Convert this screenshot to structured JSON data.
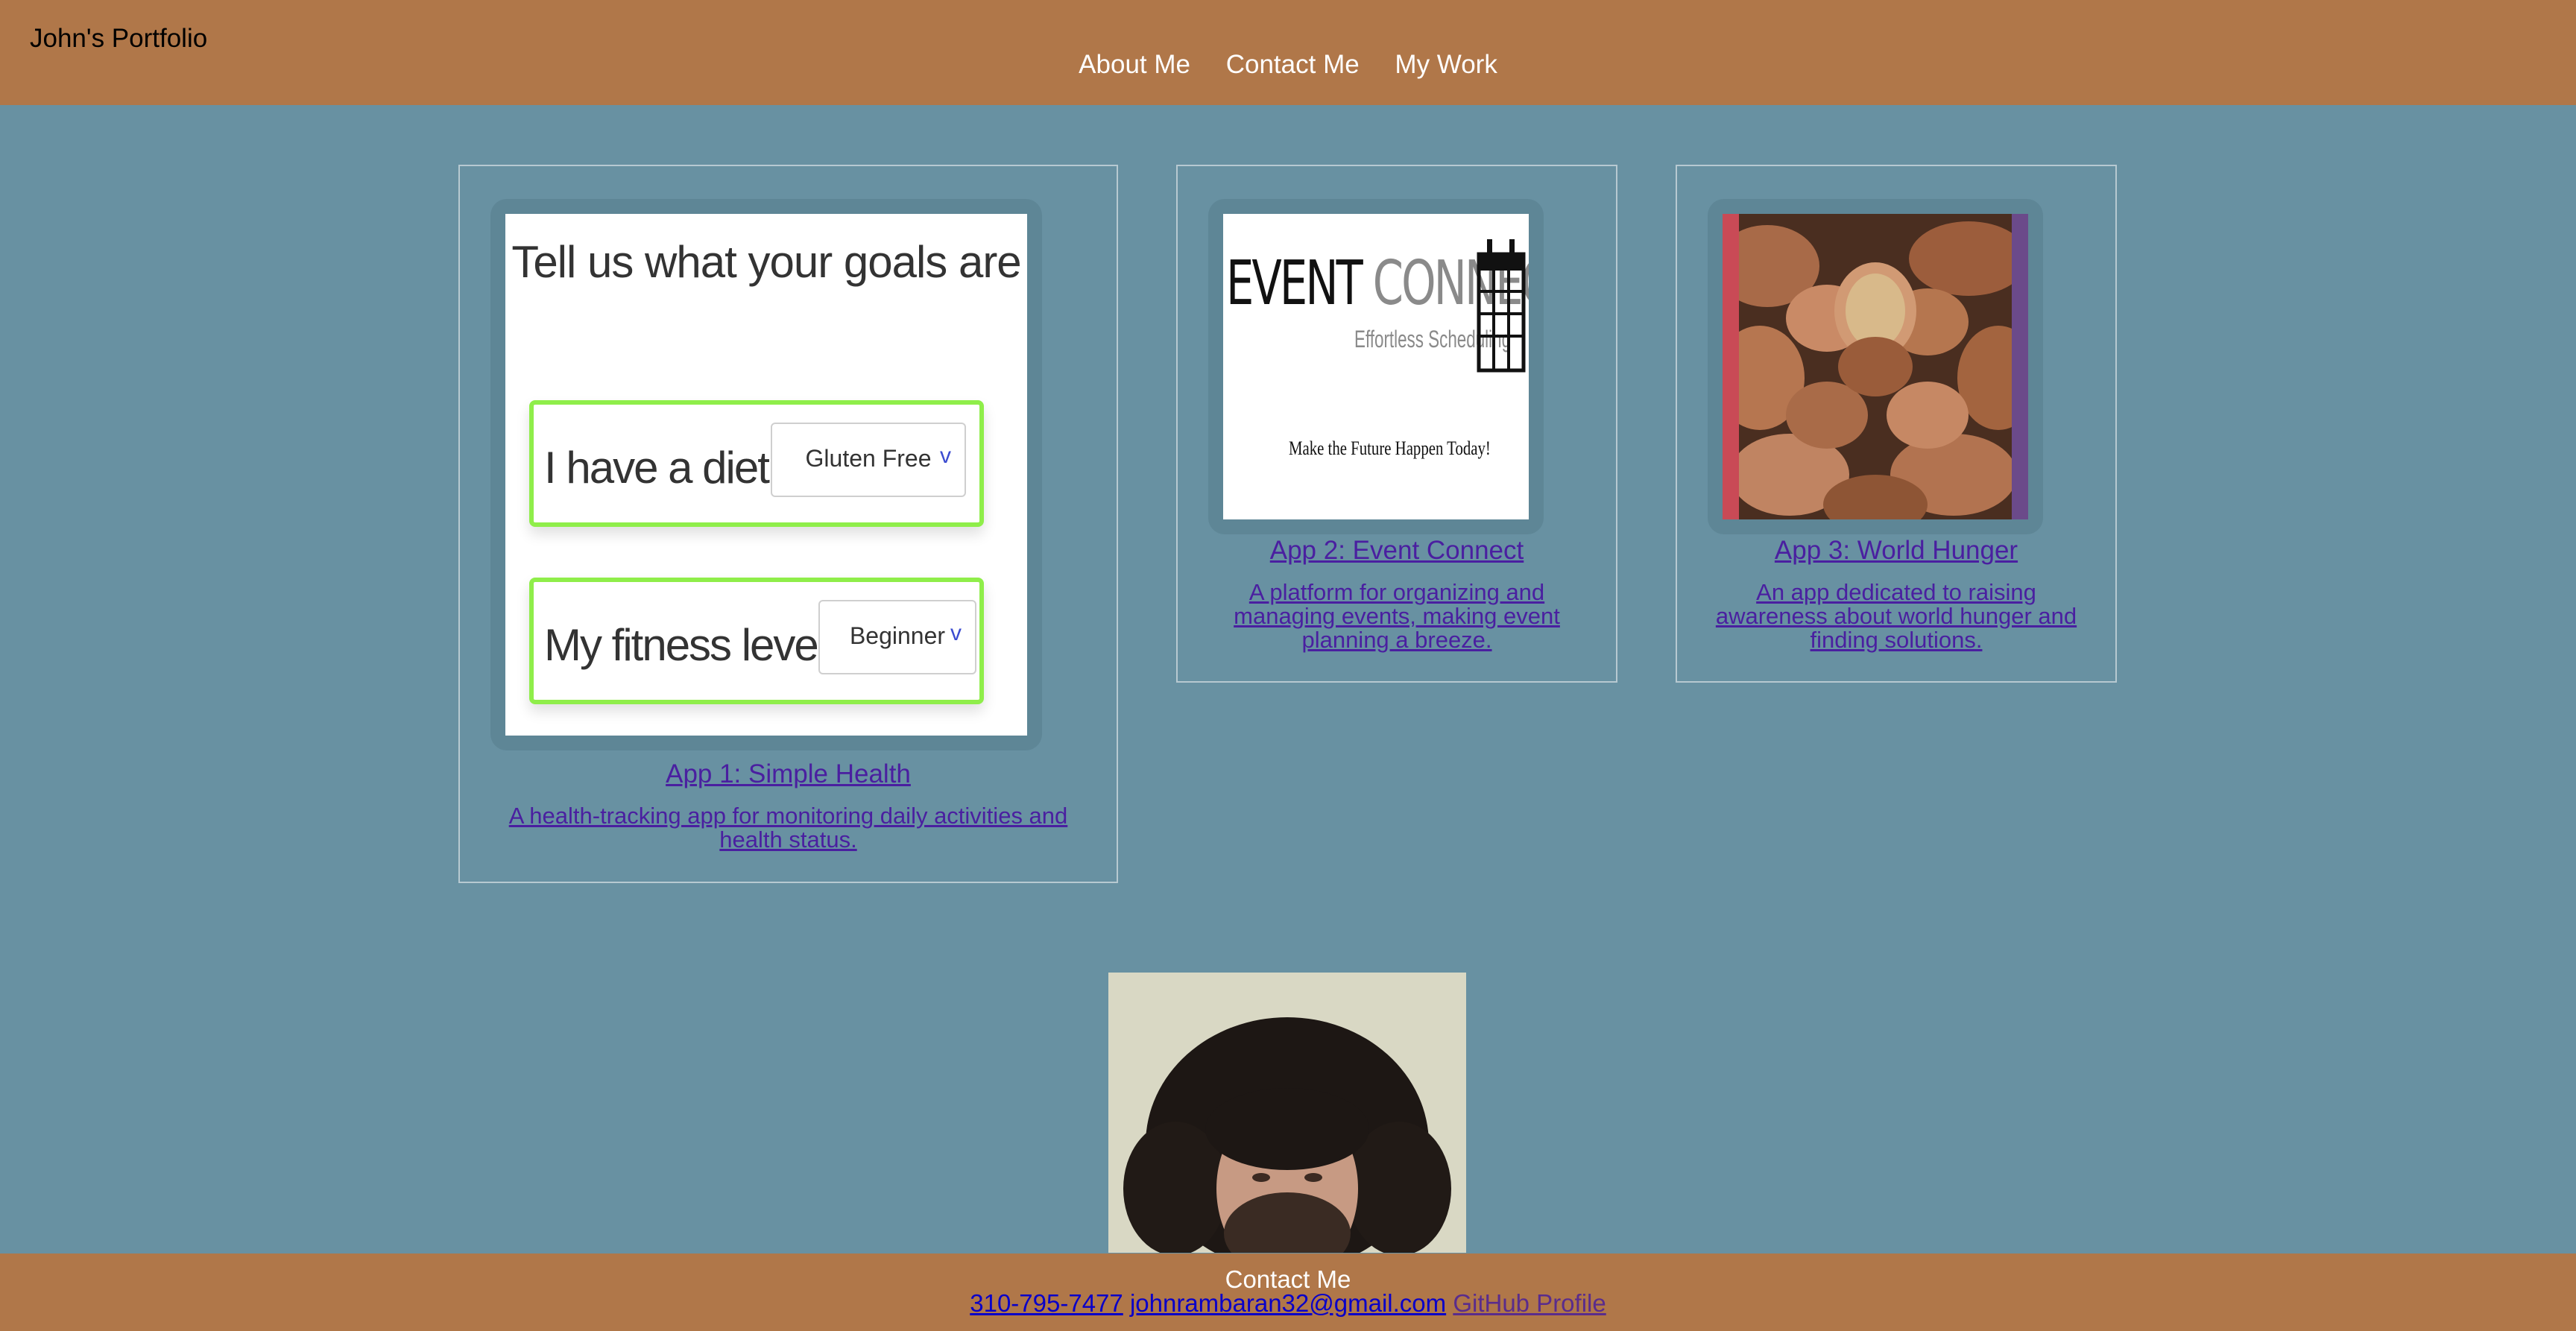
{
  "header": {
    "brand": "John's Portfolio",
    "nav": [
      "About Me",
      "Contact Me",
      "My Work"
    ]
  },
  "projects": [
    {
      "title": "App 1: Simple Health",
      "description": "A health-tracking app for monitoring daily activities and health status.",
      "thumbnail": {
        "heading": "Tell us what your goals are",
        "diet_label": "I have a diet of:",
        "diet_value": "Gluten Free",
        "fitness_label": "My fitness level is:",
        "fitness_value": "Beginner"
      }
    },
    {
      "title": "App 2: Event Connect",
      "description": "A platform for organizing and managing events, making event planning a breeze.",
      "thumbnail": {
        "logo_word1": "EVENT",
        "logo_word2": "CONNECT",
        "tagline": "Effortless Scheduling",
        "motto": "Make the Future Happen Today!"
      }
    },
    {
      "title": "App 3: World Hunger",
      "description": "An app dedicated to raising awareness about world hunger and finding solutions."
    }
  ],
  "footer": {
    "title": "Contact Me",
    "phone": "310-795-7477",
    "email": "johnrambaran32@gmail.com",
    "github": "GitHub Profile"
  },
  "colors": {
    "header_bg": "#b07749",
    "page_bg": "#6891a2",
    "link": "#4a1fa0",
    "accent_green": "#8fee4a"
  },
  "icons": {
    "select_chevron": "chevron-down-icon",
    "calendar": "calendar-icon"
  }
}
